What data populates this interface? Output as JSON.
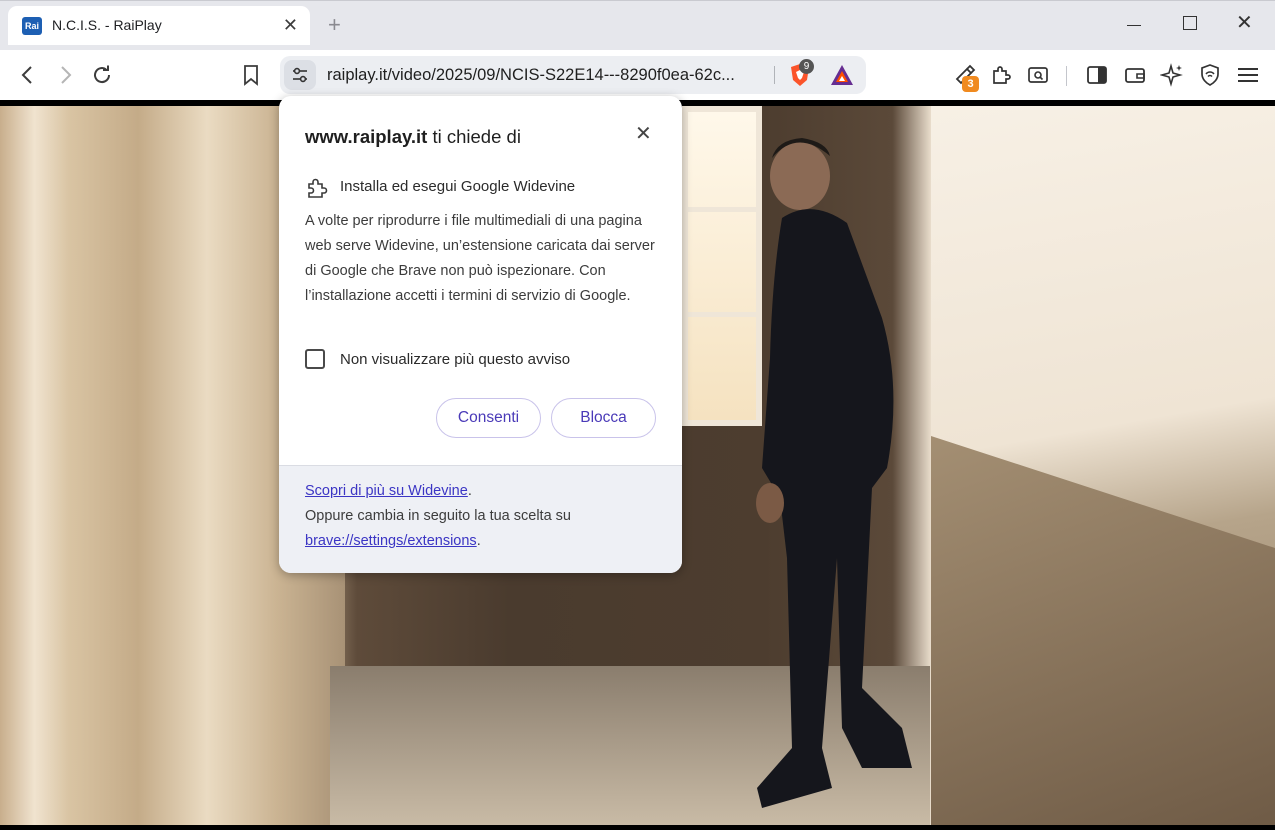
{
  "tab": {
    "favicon_text": "Rai",
    "title": "N.C.I.S. - RaiPlay",
    "close": "✕"
  },
  "tabstrip": {
    "new_tab": "+",
    "close_window": "✕"
  },
  "omnibox": {
    "url": "raiplay.it/video/2025/09/NCIS-S22E14---8290f0ea-62c...",
    "shield_count": "9"
  },
  "extensions": {
    "badge_count": "3"
  },
  "popup": {
    "title_site": "www.raiplay.it",
    "title_rest": " ti chiede di",
    "close": "✕",
    "permission": "Installa ed esegui Google Widevine",
    "description": "A volte per riprodurre i file multimediali di una pagina web serve Widevine, un’estensione caricata dai server di Google che Brave non può ispezionare. Con l’installazione accetti i termini di servizio di Google.",
    "checkbox_label": "Non visualizzare più questo avviso",
    "allow": "Consenti",
    "block": "Blocca",
    "footer_link": "Scopri di più su Widevine",
    "footer_period1": ".",
    "footer_text": "Oppure cambia in seguito la tua scelta su ",
    "footer_link2": "brave://settings/extensions",
    "footer_period2": "."
  },
  "colors": {
    "accent": "#4a3ab8",
    "link": "#3b35c4",
    "brave_orange": "#fb542b",
    "badge_orange": "#f08a1f"
  },
  "icons": [
    "back-icon",
    "forward-icon",
    "reload-icon",
    "bookmark-icon",
    "site-settings-icon",
    "brave-shield-icon",
    "brave-rewards-icon",
    "extension-icon",
    "puzzle-icon",
    "search-tab-icon",
    "sidebar-icon",
    "wallet-icon",
    "leo-ai-icon",
    "vpn-icon",
    "menu-icon",
    "close-icon"
  ]
}
